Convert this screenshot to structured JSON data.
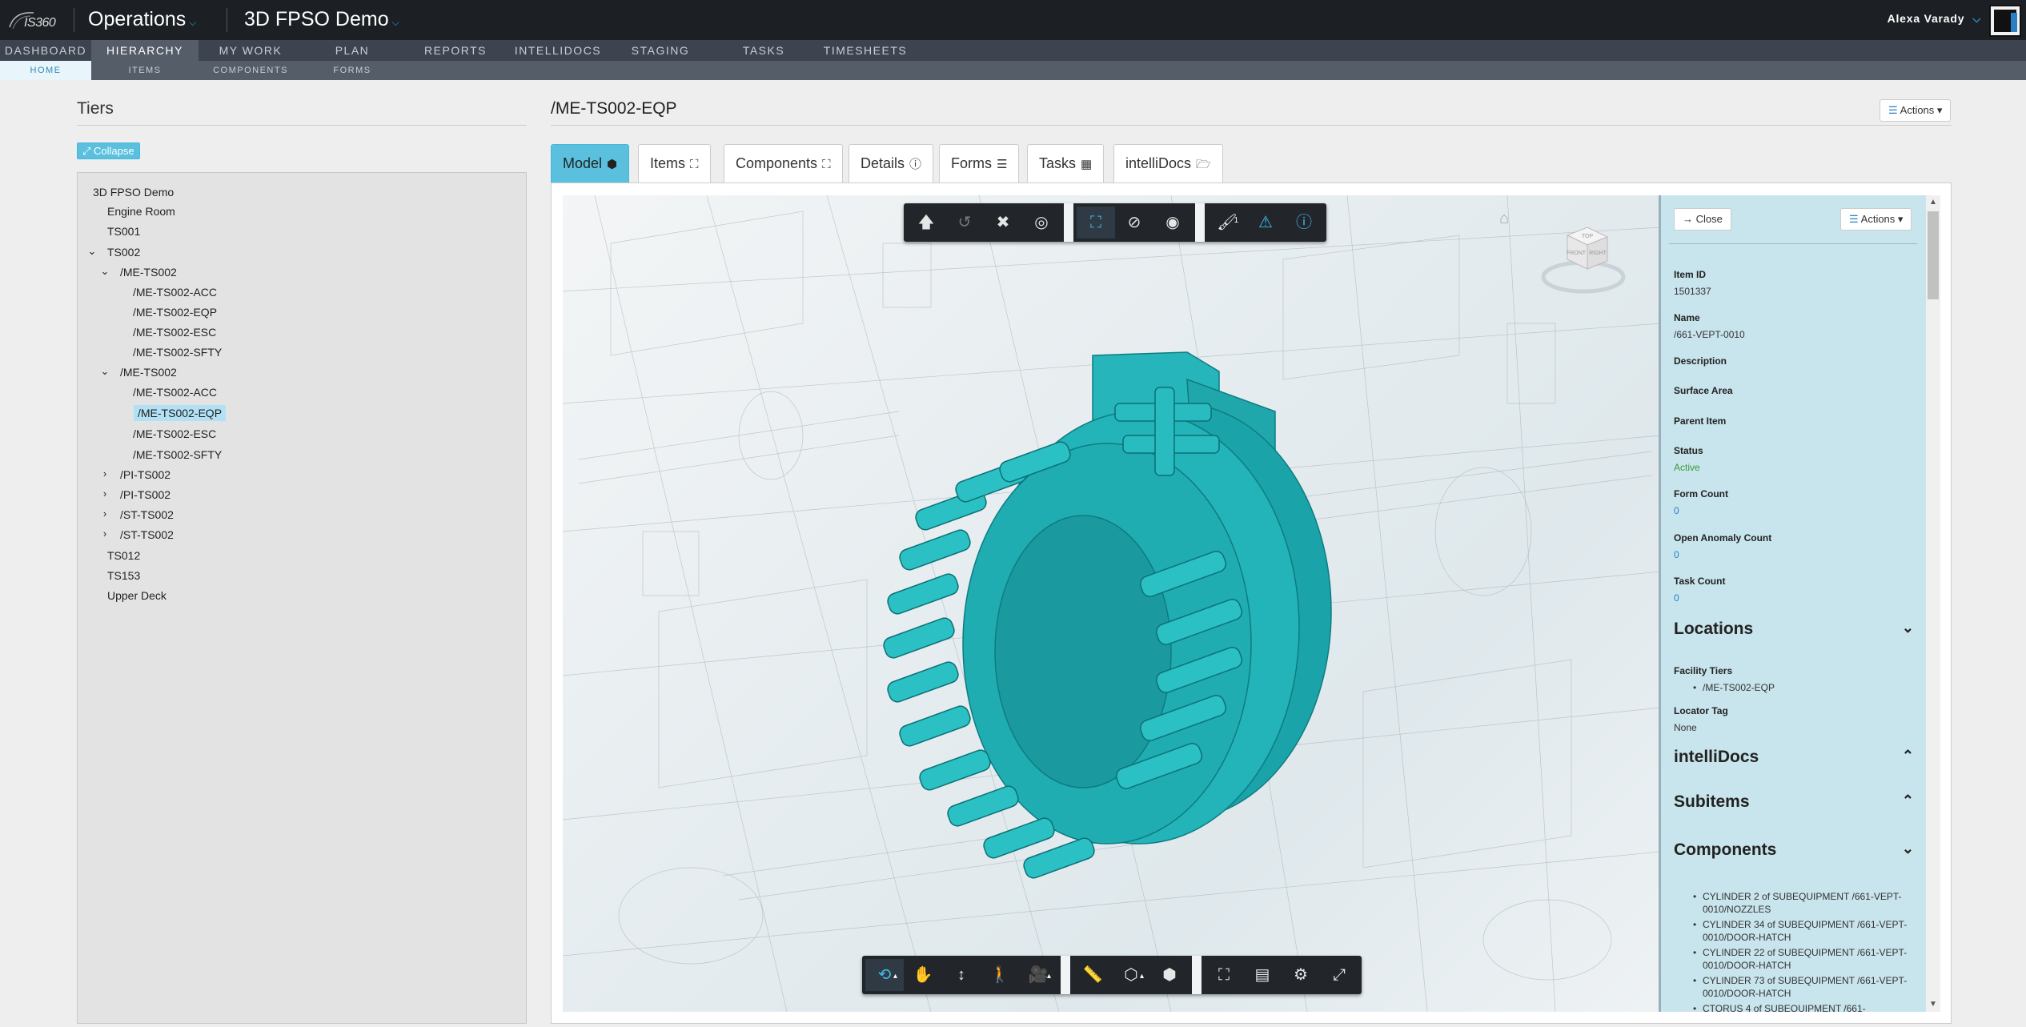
{
  "app": {
    "logo_text": "IS360",
    "module": "Operations",
    "project": "3D FPSO Demo",
    "user": "Alexa Varady"
  },
  "nav": {
    "items": [
      "DASHBOARD",
      "HIERARCHY",
      "MY WORK",
      "PLAN",
      "REPORTS",
      "INTELLIDOCS",
      "STAGING",
      "TASKS",
      "TIMESHEETS"
    ],
    "active": "HIERARCHY",
    "sub_items": [
      "HOME",
      "ITEMS",
      "COMPONENTS",
      "FORMS"
    ],
    "sub_active": "HOME"
  },
  "tiers": {
    "title": "Tiers",
    "collapse_label": "Collapse",
    "nodes": [
      "3D FPSO Demo",
      "Engine Room",
      "TS001",
      "TS002",
      "/ME-TS002",
      "/ME-TS002-ACC",
      "/ME-TS002-EQP",
      "/ME-TS002-ESC",
      "/ME-TS002-SFTY",
      "/ME-TS002",
      "/ME-TS002-ACC",
      "/ME-TS002-EQP",
      "/ME-TS002-ESC",
      "/ME-TS002-SFTY",
      "/PI-TS002",
      "/PI-TS002",
      "/ST-TS002",
      "/ST-TS002",
      "TS012",
      "TS153",
      "Upper Deck"
    ]
  },
  "main": {
    "title": "/ME-TS002-EQP",
    "actions_label": "Actions",
    "tabs": [
      "Model",
      "Items",
      "Components",
      "Details",
      "Forms",
      "Tasks",
      "intelliDocs"
    ],
    "active_tab": "Model"
  },
  "viewer": {
    "top_badge": "1",
    "viewcube_faces": [
      "TOP",
      "FRONT",
      "RIGHT"
    ]
  },
  "props": {
    "close_label": "Close",
    "actions_label": "Actions",
    "item_id_label": "Item ID",
    "item_id": "1501337",
    "name_label": "Name",
    "name": "/661-VEPT-0010",
    "description_label": "Description",
    "surface_area_label": "Surface Area",
    "parent_item_label": "Parent Item",
    "status_label": "Status",
    "status": "Active",
    "form_count_label": "Form Count",
    "form_count": "0",
    "open_anomaly_label": "Open Anomaly Count",
    "open_anomaly": "0",
    "task_count_label": "Task Count",
    "task_count": "0",
    "locations_title": "Locations",
    "facility_tiers_label": "Facility Tiers",
    "facility_tier": "/ME-TS002-EQP",
    "locator_tag_label": "Locator Tag",
    "locator_tag": "None",
    "intellidocs_title": "intelliDocs",
    "subitems_title": "Subitems",
    "components_title": "Components",
    "components": [
      "CYLINDER 2 of SUBEQUIPMENT /661-VEPT-0010/NOZZLES",
      "CYLINDER 34 of SUBEQUIPMENT /661-VEPT-0010/DOOR-HATCH",
      "CYLINDER 22 of SUBEQUIPMENT /661-VEPT-0010/DOOR-HATCH",
      "CYLINDER 73 of SUBEQUIPMENT /661-VEPT-0010/DOOR-HATCH",
      "CTORUS 4 of SUBEQUIPMENT /661-"
    ]
  },
  "colors": {
    "topbar": "#1c1f24",
    "nav": "#3d4450",
    "accent": "#5bc0de",
    "model": "#1fb3b8",
    "props_bg": "#c8e4ec"
  }
}
